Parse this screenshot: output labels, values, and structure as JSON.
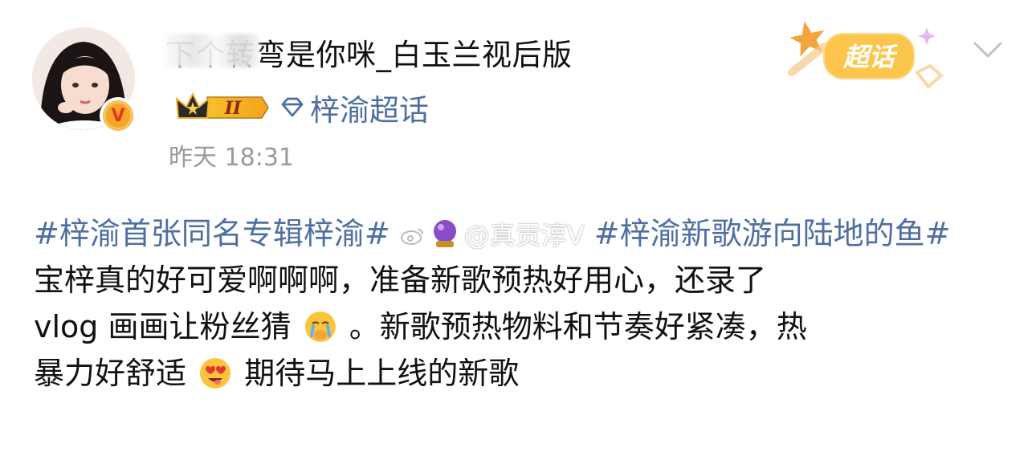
{
  "post": {
    "username": "下个转弯是你咪_白玉兰视后版",
    "level_badge": "II",
    "topic_tag": "梓渝超话",
    "timestamp": "昨天 18:31",
    "supertopic_label": "超话",
    "content": {
      "hashtag1": "#梓渝首张同名专辑梓渝#",
      "hashtag2": "#梓渝新歌游向陆地的鱼#",
      "watermark": "@真贡淳V",
      "line2": "宝梓真的好可爱啊啊啊，准备新歌预热好用心，还录了",
      "line3a": "vlog 画画让粉丝猜",
      "line3b": "。新歌预热物料和节奏好紧凑，热",
      "line4a": "暴力好舒适",
      "line4b": "期待马上上线的新歌"
    }
  },
  "colors": {
    "hashtag": "#4f6fa3",
    "timestamp": "#9a9a9a",
    "vip_badge": "#f5a623"
  },
  "icons": {
    "verified": "v-badge-icon",
    "level": "crown-level-icon",
    "topic": "diamond-icon",
    "more": "chevron-down-icon"
  }
}
